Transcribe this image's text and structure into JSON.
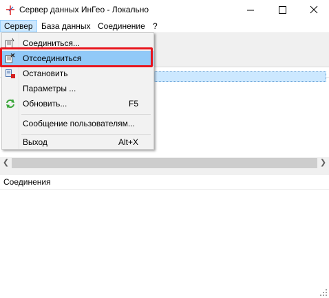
{
  "window": {
    "title": "Сервер данных ИнГео - Локально"
  },
  "menubar": {
    "items": [
      "Сервер",
      "База данных",
      "Соединение",
      "?"
    ]
  },
  "dropdown": {
    "items": [
      {
        "label": "Соединиться...",
        "shortcut": "",
        "icon": "connect-icon"
      },
      {
        "label": "Отсоединиться",
        "shortcut": "",
        "icon": "disconnect-icon"
      },
      {
        "label": "Остановить",
        "shortcut": "",
        "icon": "stop-server-icon"
      },
      {
        "label": "Параметры ...",
        "shortcut": "",
        "icon": ""
      },
      {
        "label": "Обновить...",
        "shortcut": "F5",
        "icon": "refresh-icon"
      },
      {
        "label": "Сообщение пользователям...",
        "shortcut": "",
        "icon": ""
      },
      {
        "label": "Выход",
        "shortcut": "Alt+X",
        "icon": ""
      }
    ]
  },
  "panels": {
    "connections_header": "Соединения"
  },
  "colors": {
    "highlight": "#91c9f7",
    "annotation_box": "#e8141c",
    "menu_active": "#cce8ff"
  }
}
